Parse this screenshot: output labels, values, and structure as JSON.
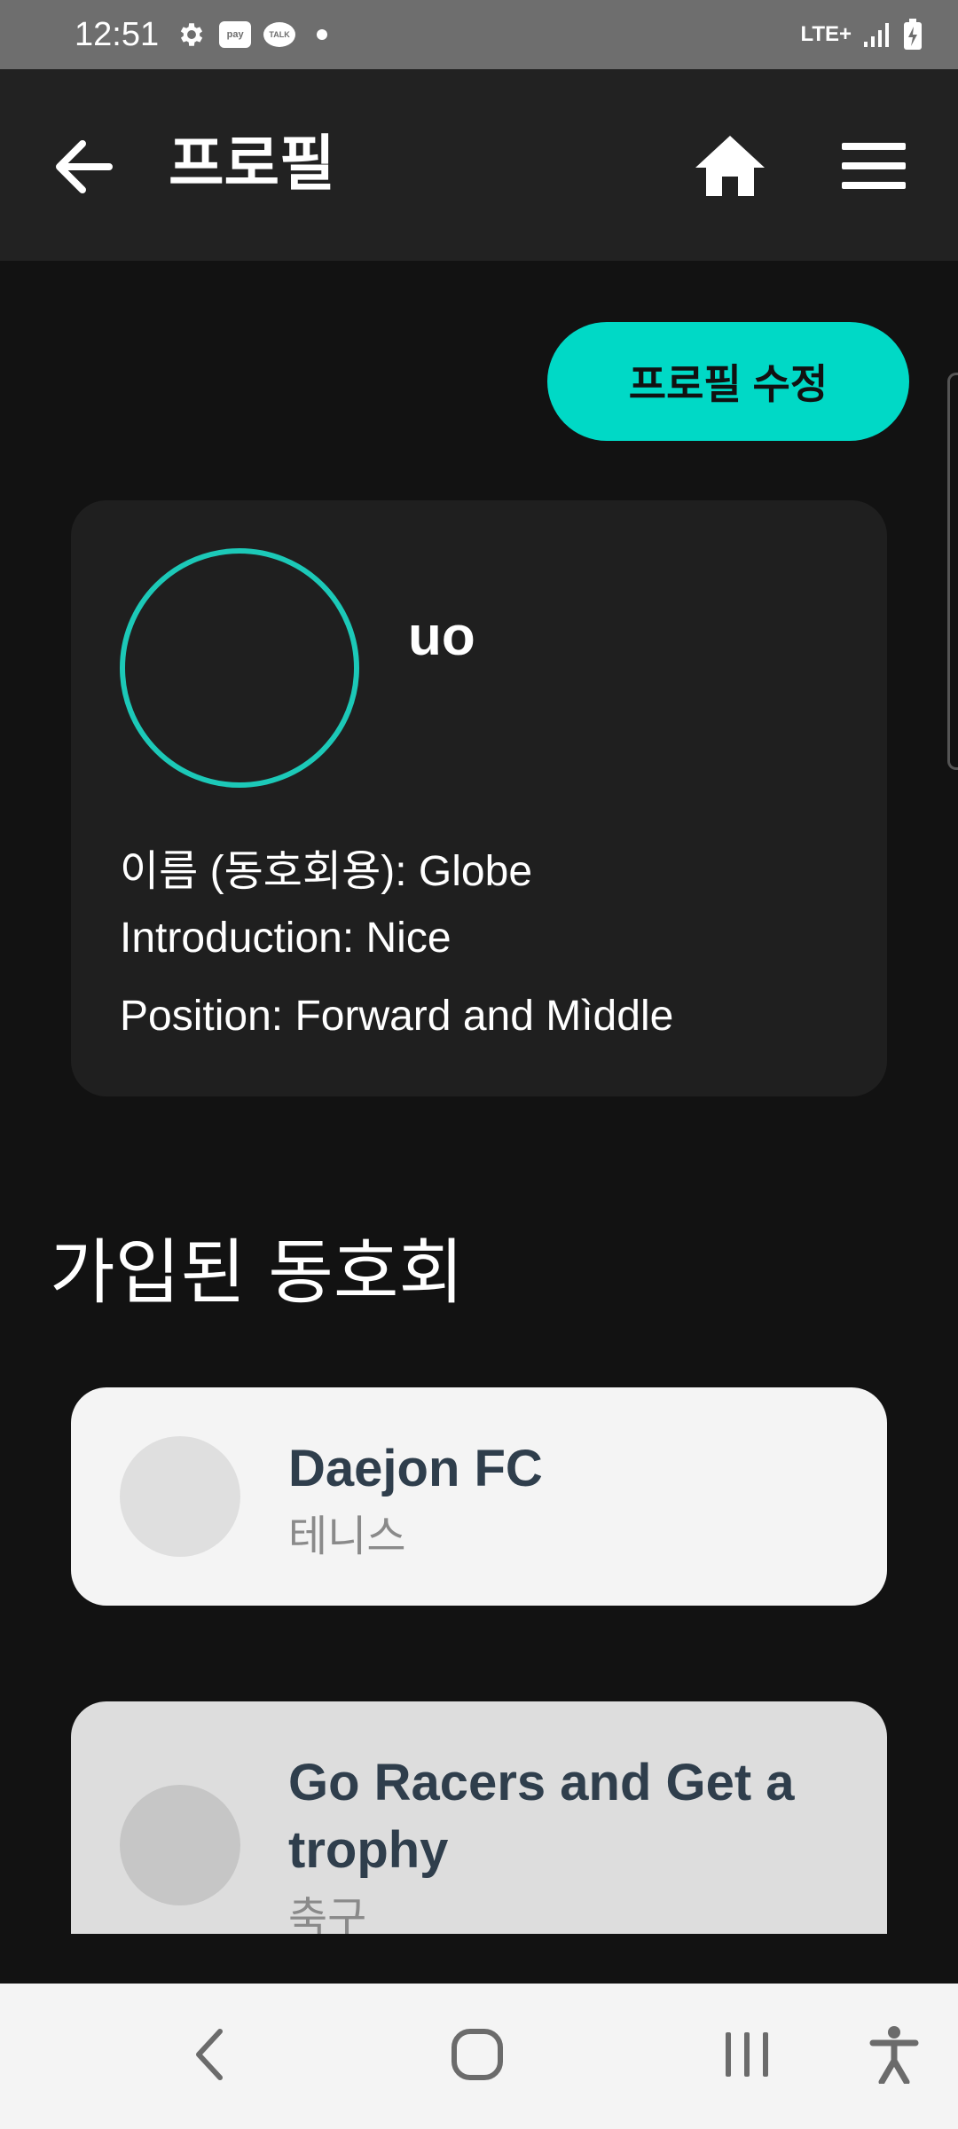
{
  "status_bar": {
    "time": "12:51",
    "pay_label": "pay",
    "talk_label": "TALK",
    "network": "LTE+"
  },
  "app_bar": {
    "title": "프로필"
  },
  "edit_profile_label": "프로필 수정",
  "profile": {
    "username": "uo",
    "name_line": "이름 (동호회용): Globe",
    "introduction_line": "Introduction: Nice",
    "position_line": "Position: Forward and Mìddle"
  },
  "clubs_section": {
    "title": "가입된 동호회",
    "clubs": [
      {
        "name": "Daejon FC",
        "category": "테니스"
      },
      {
        "name": "Go Racers and Get a trophy",
        "category": "축구"
      }
    ]
  },
  "colors": {
    "accent": "#00d9c6",
    "background": "#121212",
    "card": "#1f1f1f",
    "app_bar": "#222222"
  },
  "icons": [
    "back-arrow-icon",
    "home-icon",
    "menu-icon",
    "settings-icon",
    "nav-back-icon",
    "nav-home-icon",
    "nav-recents-icon",
    "accessibility-icon"
  ]
}
